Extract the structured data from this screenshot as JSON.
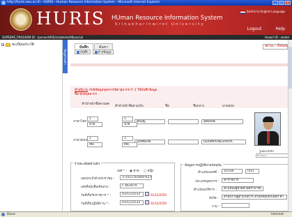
{
  "window": {
    "title": "http://hurls.swu.ac.th - HURIS - Human Resource Information System - Microsoft Internet Explorer",
    "controls": [
      "_",
      "□",
      "x"
    ]
  },
  "header": {
    "brand": "HURIS",
    "system_name": "HUman Resource Information System",
    "university": "Srinakharinwirot University",
    "language_link": "Switch to English Language",
    "nav": [
      "Logout",
      "Help"
    ]
  },
  "program_bar": {
    "left": "SUPREME_PROGRAM ID : /personHRIS/residents/HRjournal",
    "right": "Huaorl ID : amdel"
  },
  "sidebar": {
    "tree_root": "ทะเบียนประวัติ",
    "side_tab": "ข้อมูลส่วนตัว"
  },
  "main": {
    "tabs": [
      "บันทึก",
      "ค้นหา"
    ],
    "toolbar": {
      "save": "บันทึก",
      "clear": "ล้างข้อมูล"
    },
    "dropdown_right": "สถานะ : ทั้งหมด",
    "id_label": "เลขประจำตัวบุคลากร * :",
    "id_value": "100136",
    "notice_link": "คำอธิบาย",
    "notice_text": "กรณีข้อมูลบุคลากรมีอายุมากกว่า 1 ให้บันทึกข้อมูล",
    "notice_text2": "ชื่อ-สกุลบุคลากร",
    "columns": [
      "คำนำหน้าชื่อตามยศ",
      "คำนำหน้าชื่อตามเงิน",
      "ชื่อ",
      "ชื่อกลาง",
      "นามสกุล"
    ],
    "thai_row_label": "ภาษาไทย",
    "thai_values": [
      "1",
      "1",
      "สมบุญ",
      "",
      "อุดมพงษ์"
    ],
    "thai_sub": [
      "นาย",
      "นาย"
    ],
    "eng_row_label": "ภาษาอังกฤษ",
    "eng_values": [
      "1",
      "1",
      "SOMBUN",
      "",
      "UDOMPONGVIRIYA"
    ],
    "eng_sub": [
      "MR.",
      "MR."
    ],
    "photo_caption": "รูปประจำตัว",
    "photo_browse": "Browse...",
    "left_group": {
      "legend": "รายละเอียดส่วนตัว",
      "gender_label": "เพศ * :",
      "gender_options": [
        "ชาย",
        "หญิง"
      ],
      "national_id_label": "เลขประจำตัวประชาชน :",
      "national_id": "3-1012-01669-62-6",
      "passport_label": "เลขที่หนังสือเดินทาง :",
      "passport": "F 463474",
      "start_date_label": "วันที่เริ่มรับราชการ * :",
      "start_date": "01/11/2533",
      "start_hint": "01/12/2550",
      "work_date_label": "วันที่เริ่มปฏิบัติงาน * :",
      "work_date": "01/11/2533",
      "work_hint": "01/12/2550"
    },
    "right_group": {
      "legend": "ข้อมูลการปฏิบัติงานปัจจุบัน",
      "position_no_label": "ตำแหน่งเลขที่ :",
      "position_no": "10136",
      "position_no_code": "(01)",
      "personnel_type_label": "ประเภทบุคลากร :",
      "personnel_type": "ข้าราชการ",
      "position_label": "ตำแหน่งบริหาร :",
      "position": "ตำแหน่งผู้ช่วยศาสตราจารย์",
      "affiliation_label": "สังกัด :",
      "affiliation": "สำนักงานผู้อำนวยการ สำนักคอมพิวเตอร์ คำ",
      "unit_label": "งาน :"
    }
  },
  "statusbar": {
    "left": "Done",
    "zone": "Internet"
  }
}
